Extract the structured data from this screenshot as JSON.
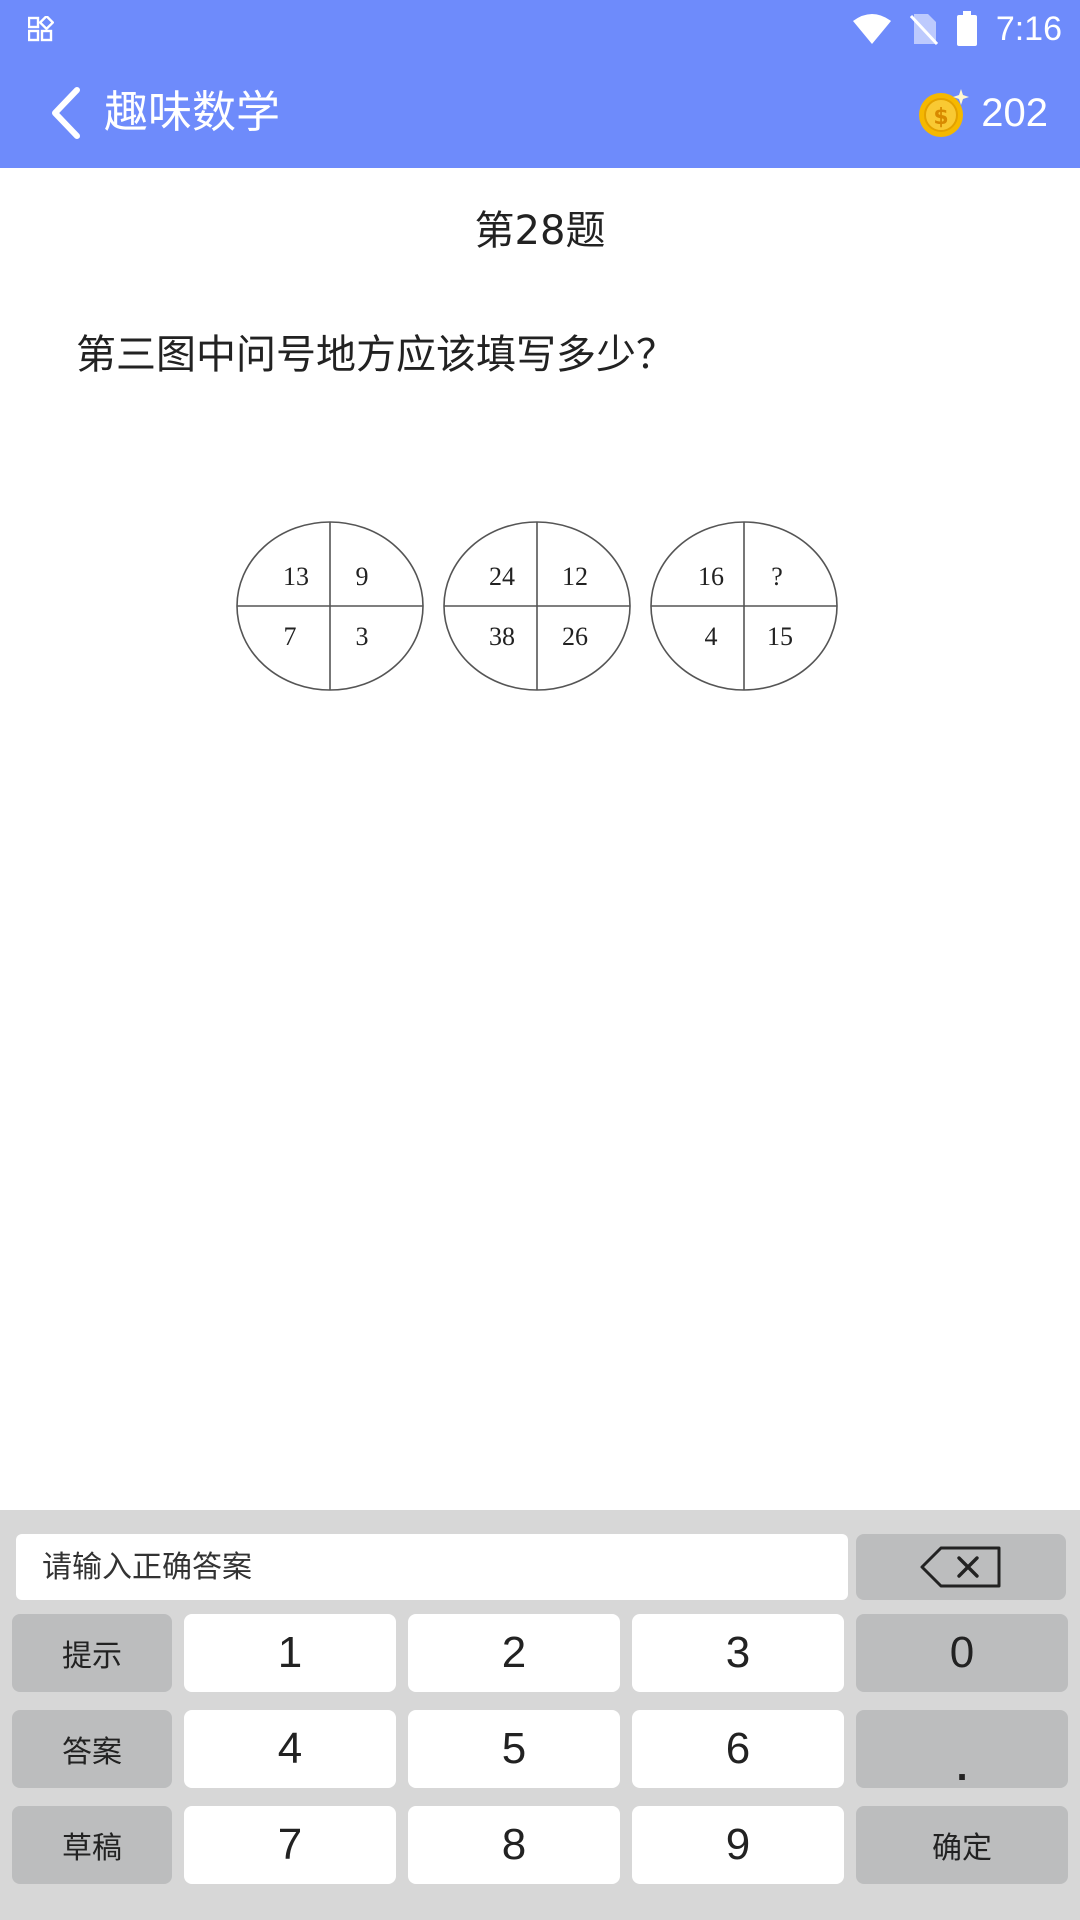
{
  "status_bar": {
    "time": "7:16",
    "icons": [
      "notification-grid-icon",
      "wifi-icon",
      "no-sim-icon",
      "battery-icon"
    ]
  },
  "app_bar": {
    "title": "趣味数学",
    "coin_count": "202",
    "icons": [
      "back-arrow-icon",
      "gold-coin-icon"
    ]
  },
  "question": {
    "number_label": "第28题",
    "text": "第三图中问号地方应该填写多少？"
  },
  "puzzle": {
    "circles": [
      {
        "top_left": "13",
        "top_right": "9",
        "bottom_left": "7",
        "bottom_right": "3"
      },
      {
        "top_left": "24",
        "top_right": "12",
        "bottom_left": "38",
        "bottom_right": "26"
      },
      {
        "top_left": "16",
        "top_right": "?",
        "bottom_left": "4",
        "bottom_right": "15"
      }
    ]
  },
  "keypad": {
    "input_placeholder": "请输入正确答案",
    "backspace_icon": "backspace-icon",
    "hint": "提示",
    "answer": "答案",
    "draft": "草稿",
    "confirm": "确定",
    "dot": ".",
    "digits": [
      "1",
      "2",
      "3",
      "0",
      "4",
      "5",
      "6",
      "7",
      "8",
      "9"
    ]
  },
  "colors": {
    "header_blue": "#6e8bfb",
    "keypad_bg": "#d7d7d7",
    "gray_key": "#bcbdbe",
    "coin_gold": "#f5b800"
  }
}
